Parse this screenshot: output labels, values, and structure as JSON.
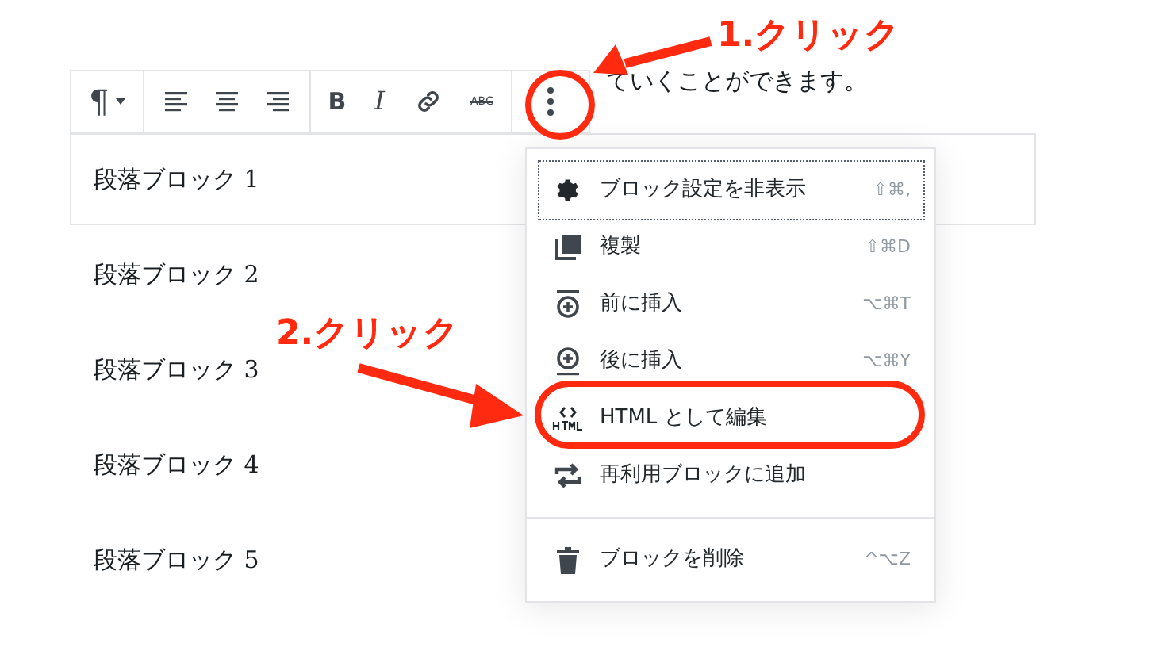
{
  "intro_text": "ていくことができます。",
  "toolbar": {
    "groups": [
      {
        "items": [
          {
            "kind": "text",
            "label": "¶"
          }
        ]
      },
      {
        "items": [
          {
            "kind": "icon"
          },
          {
            "kind": "icon"
          },
          {
            "kind": "icon"
          }
        ]
      },
      {
        "items": [
          {
            "kind": "text",
            "label": "B"
          },
          {
            "kind": "text",
            "label": "I"
          },
          {
            "kind": "icon"
          },
          {
            "kind": "text",
            "label": "ABC"
          }
        ]
      },
      {
        "items": [
          {
            "kind": "icon"
          }
        ]
      }
    ]
  },
  "paragraphs": [
    {
      "text": "段落ブロック 1",
      "selected": true
    },
    {
      "text": "段落ブロック 2",
      "selected": false
    },
    {
      "text": "段落ブロック 3",
      "selected": false
    },
    {
      "text": "段落ブロック 4",
      "selected": false
    },
    {
      "text": "段落ブロック 5",
      "selected": false
    }
  ],
  "menu": {
    "sections": [
      {
        "items": [
          {
            "label": "ブロック設定を非表示",
            "shortcut": "⇧⌘,",
            "selected": true
          },
          {
            "label": "複製",
            "shortcut": "⇧⌘D",
            "selected": false
          },
          {
            "label": "前に挿入",
            "shortcut": "⌥⌘T",
            "selected": false
          },
          {
            "label": "後に挿入",
            "shortcut": "⌥⌘Y",
            "selected": false
          },
          {
            "label": "HTML として編集",
            "selected": false
          },
          {
            "label": "再利用ブロックに追加",
            "selected": false
          }
        ]
      },
      {
        "items": [
          {
            "label": "ブロックを削除",
            "shortcut": "^⌥Z",
            "selected": false
          }
        ]
      }
    ]
  },
  "annotations": [
    {
      "text": "1.クリック"
    },
    {
      "text": "2.クリック"
    }
  ]
}
